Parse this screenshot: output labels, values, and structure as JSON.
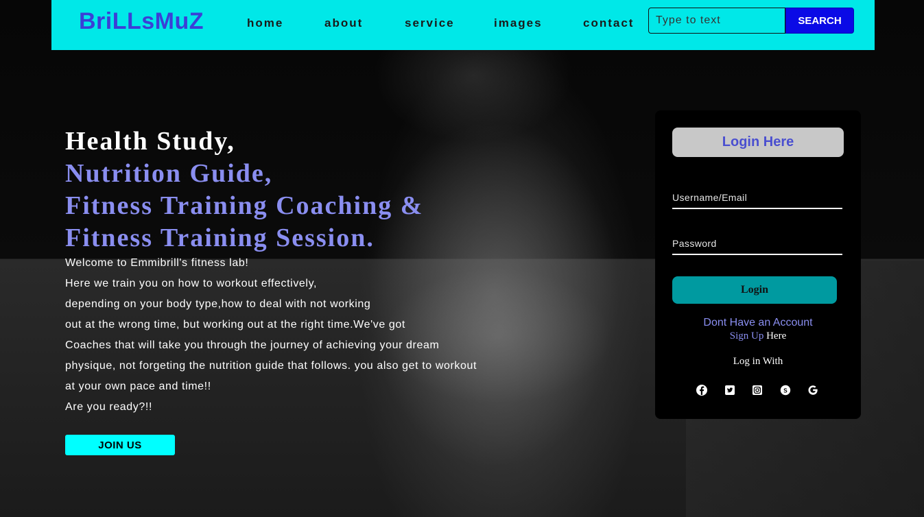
{
  "header": {
    "logo": "BriLLsMuZ",
    "nav": [
      {
        "label": "home"
      },
      {
        "label": "about"
      },
      {
        "label": "service"
      },
      {
        "label": "images"
      },
      {
        "label": "contact"
      }
    ],
    "search": {
      "placeholder": "Type to text",
      "button_label": "SEARCH"
    }
  },
  "hero": {
    "title_line1": "Health Study,",
    "title_line2": "Nutrition Guide,",
    "title_line3": "Fitness Training Coaching &",
    "title_line4": "Fitness Training Session.",
    "body_lines": [
      "Welcome to Emmibrill's fitness lab!",
      "Here we train you on how to workout effectively,",
      "depending on your body type,how to deal with not working",
      "out at the wrong time, but working out at the right time.We've got",
      "Coaches that will take you through the journey of achieving your dream",
      "physique, not forgeting the nutrition guide that follows. you also get to workout",
      "at your own pace and time!!",
      "Are you ready?!!"
    ],
    "join_button": "JOIN US"
  },
  "login": {
    "heading": "Login Here",
    "username_placeholder": "Username/Email",
    "password_placeholder": "Password",
    "button": "Login",
    "no_account": "Dont Have an Account",
    "signup_link": "Sign Up",
    "signup_suffix": " Here",
    "login_with": "Log in With",
    "socials": [
      "facebook-icon",
      "twitter-icon",
      "instagram-icon",
      "skype-icon",
      "google-icon"
    ]
  },
  "colors": {
    "navbar": "#00e8e8",
    "logo": "#3b3fd6",
    "accent_purple": "#8a8ef0",
    "search_button": "#0a0ae6",
    "join_button": "#00ffff",
    "login_button": "#009aa0",
    "login_heading_bg": "#c8c8c8"
  }
}
